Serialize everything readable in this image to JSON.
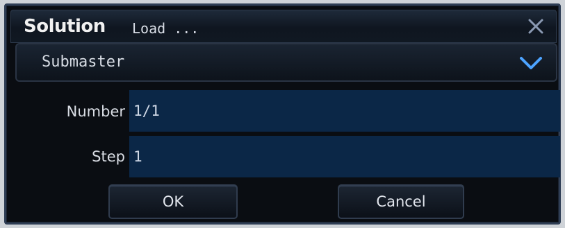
{
  "window": {
    "brand": "Solution",
    "title": "Load ..."
  },
  "dropdown": {
    "selected": "Submaster"
  },
  "fields": [
    {
      "label": "Number",
      "value": "1/1"
    },
    {
      "label": "Step",
      "value": "1"
    }
  ],
  "buttons": {
    "ok_label": "OK",
    "cancel_label": "Cancel"
  },
  "icons": {
    "close": "close-icon",
    "dropdown": "chevron-down-icon"
  },
  "colors": {
    "accent": "#0b2747",
    "chevron": "#4da3ff"
  }
}
